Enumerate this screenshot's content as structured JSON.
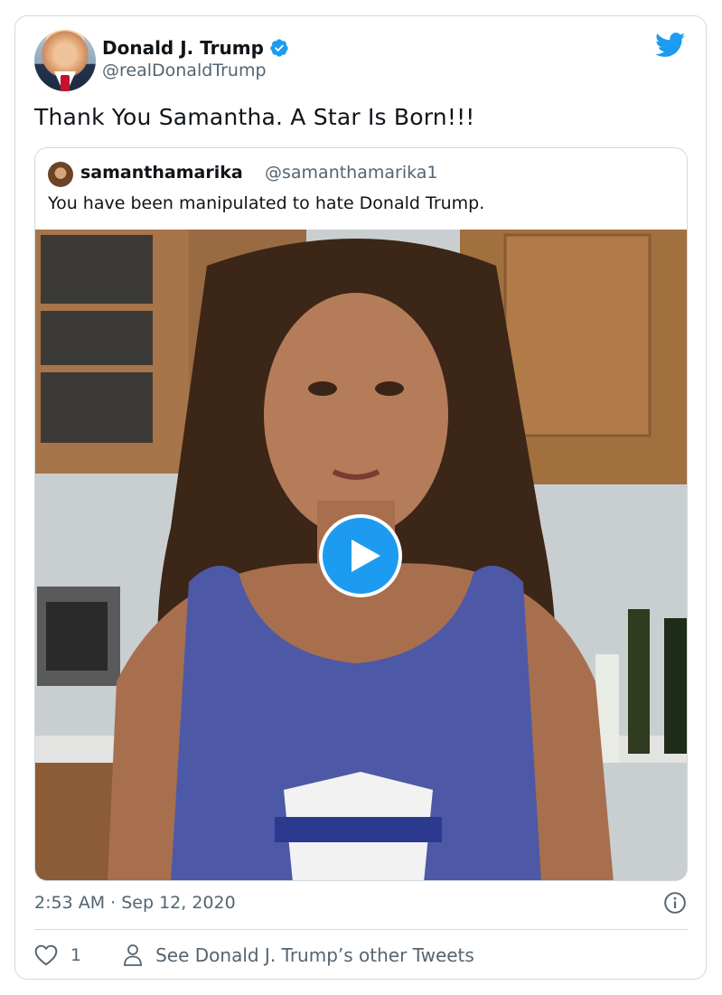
{
  "tweet": {
    "author": {
      "display_name": "Donald J. Trump",
      "handle": "@realDonaldTrump",
      "verified": true
    },
    "text": "Thank You Samantha. A Star Is Born!!!",
    "quoted_tweet": {
      "author_name": "samanthamarika",
      "author_handle": "@samanthamarika1",
      "text": "You have been manipulated to hate Donald Trump.",
      "media": {
        "type": "video"
      }
    },
    "timestamp": "2:53 AM · Sep 12, 2020",
    "actions": {
      "like_count": "1",
      "other_tweets_label": "See Donald J. Trump’s other Tweets"
    }
  },
  "icons": {
    "brand": "twitter-bird-icon",
    "verified": "verified-badge-icon",
    "info": "info-icon",
    "like": "heart-icon",
    "profile": "person-icon",
    "play": "play-icon"
  },
  "colors": {
    "brand_blue": "#1d9bf0",
    "text_primary": "#0f1419",
    "text_secondary": "#536471",
    "border": "#cfd9de"
  }
}
